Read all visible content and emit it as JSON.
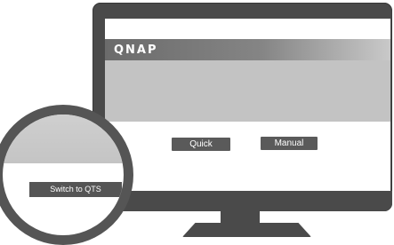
{
  "brand": {
    "logo_text": "QNAP"
  },
  "buttons": {
    "quick": "Quick",
    "manual": "Manual"
  },
  "magnifier": {
    "switch_label": "Switch to QTS"
  },
  "colors": {
    "bezel": "#4a4a4a",
    "button": "#5a5a5a",
    "panel": "#c3c3c3"
  }
}
